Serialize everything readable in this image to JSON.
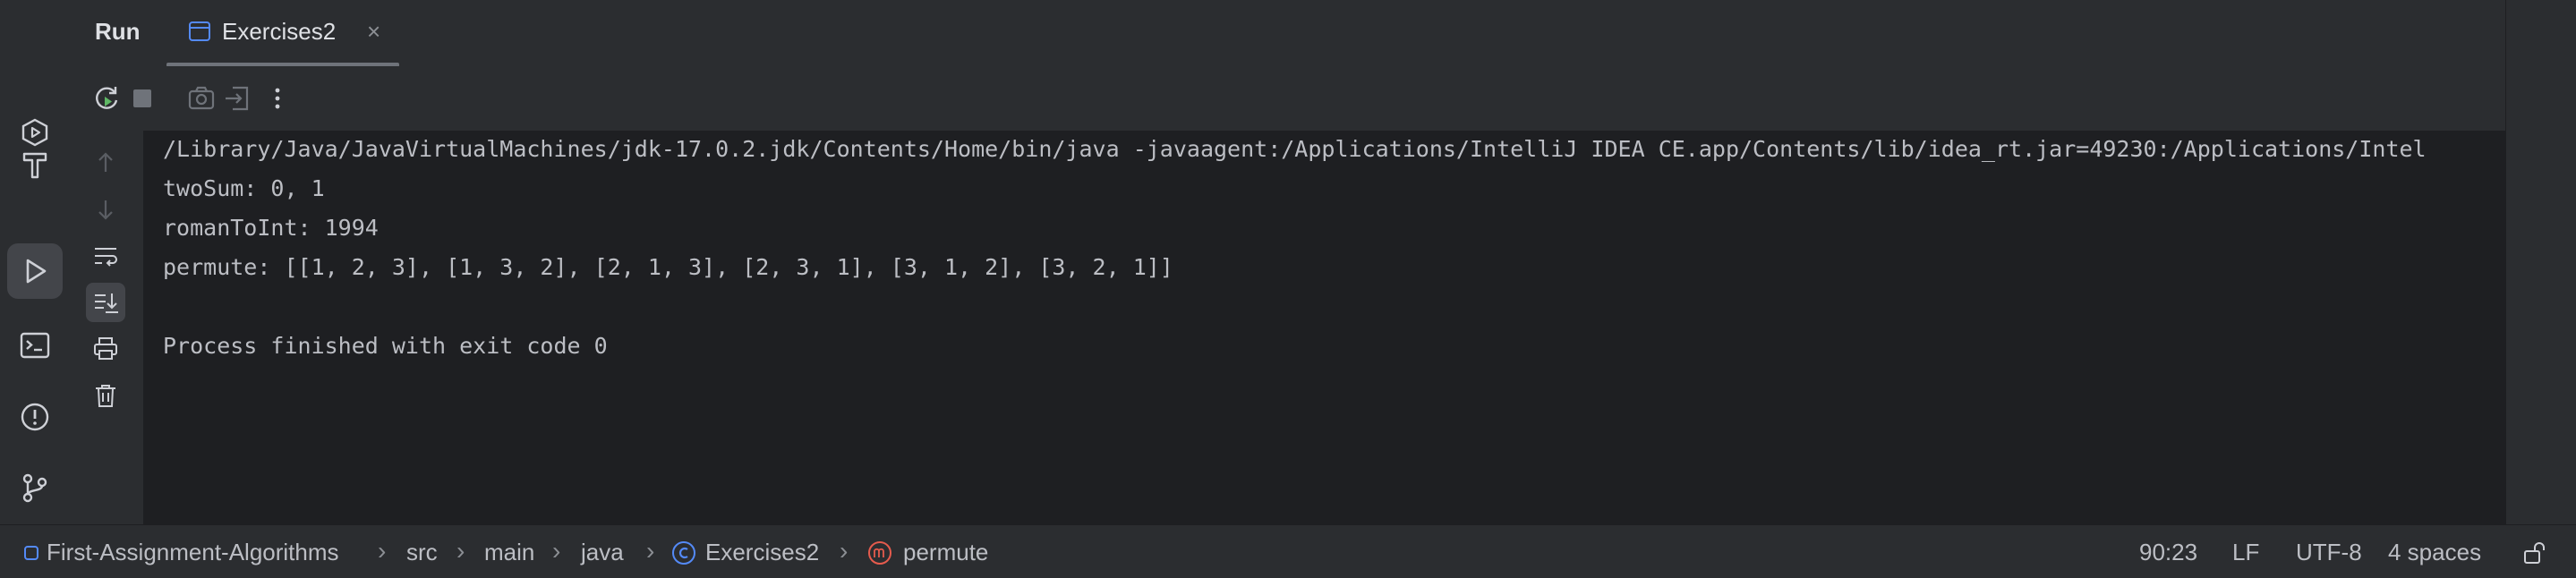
{
  "header": {
    "run_label": "Run",
    "tab": {
      "title": "Exercises2",
      "close": "×"
    }
  },
  "icons": {
    "left_strip": [
      "services-icon",
      "build-hammer-icon",
      "run-icon",
      "terminal-icon",
      "problems-icon",
      "git-icon"
    ],
    "toolbar": [
      "rerun-icon",
      "stop-icon",
      "screenshot-icon",
      "exit-icon",
      "more-icon"
    ],
    "console_tools": [
      "scroll-up-icon",
      "scroll-down-icon",
      "soft-wrap-icon",
      "scroll-to-end-icon",
      "print-icon",
      "clear-icon"
    ]
  },
  "console": {
    "lines": [
      "/Library/Java/JavaVirtualMachines/jdk-17.0.2.jdk/Contents/Home/bin/java -javaagent:/Applications/IntelliJ IDEA CE.app/Contents/lib/idea_rt.jar=49230:/Applications/Intel",
      "twoSum: 0, 1",
      "romanToInt: 1994",
      "permute: [[1, 2, 3], [1, 3, 2], [2, 1, 3], [2, 3, 1], [3, 1, 2], [3, 2, 1]]",
      "",
      "Process finished with exit code 0"
    ]
  },
  "statusbar": {
    "breadcrumbs": {
      "project": "First-Assignment-Algorithms",
      "src": "src",
      "main": "main",
      "java": "java",
      "class": "Exercises2",
      "method": "permute"
    },
    "position": "90:23",
    "line_separator": "LF",
    "encoding": "UTF-8",
    "indent": "4 spaces"
  },
  "colors": {
    "background": "#2b2d30",
    "console_bg": "#1e1f22",
    "text": "#dfe1e5",
    "run_green": "#5fb865",
    "class_blue": "#548af7",
    "method_red": "#e55b4d"
  }
}
